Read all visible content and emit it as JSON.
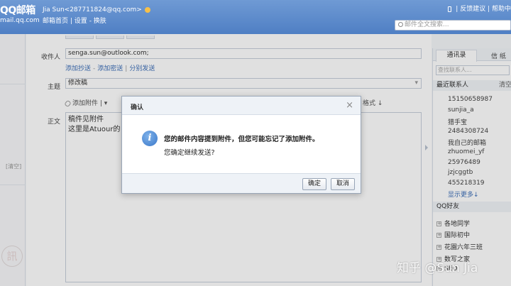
{
  "header": {
    "logo_line1": "QQ邮箱",
    "logo_line2": "mail.qq.com",
    "user": "Jia Sun<287711824@qq.com>",
    "home_link": "邮箱首页",
    "settings_link": "设置",
    "switch_link": "换肤",
    "feedback_link": "反馈建议",
    "help_link": "帮助中",
    "search_placeholder": "邮件全文搜索..."
  },
  "left": {
    "clear_label": "[清空]",
    "stamp_char": "訊"
  },
  "compose": {
    "to_label": "收件人",
    "to_value": "senga.sun@outlook.com;",
    "add_cc": "添加抄送",
    "add_bcc": "添加密送",
    "separate_send": "分别发送",
    "subject_label": "主题",
    "subject_value": "修改稿",
    "attach_label": "添加附件",
    "format_label": "格式",
    "body_label": "正文",
    "body_line1": "稿件见附件",
    "body_line2": "这里是Atuour的"
  },
  "contacts": {
    "tab_address": "通讯录",
    "tab_letter": "信 纸",
    "search_placeholder": "查找联系人...",
    "recent_label": "最近联系人",
    "clear_label": "清空",
    "recent": [
      "15150658987",
      "sunjia_a",
      "猎手宝",
      "2484308724",
      "我自己的邮箱",
      "zhuomei_yf",
      "25976489",
      "jzjcggtb",
      "455218319"
    ],
    "show_more": "显示更多↓",
    "qq_friends_label": "QQ好友",
    "groups": [
      "各地同学",
      "国际初中",
      "花園六年三班",
      "数写之家",
      "SEO"
    ]
  },
  "dialog": {
    "title": "确认",
    "close": "×",
    "message_line1": "您的邮件内容提到附件，但您可能忘记了添加附件。",
    "message_line2": "您确定继续发送?",
    "ok": "确定",
    "cancel": "取消"
  },
  "watermark": "知乎 @Sun Jia"
}
